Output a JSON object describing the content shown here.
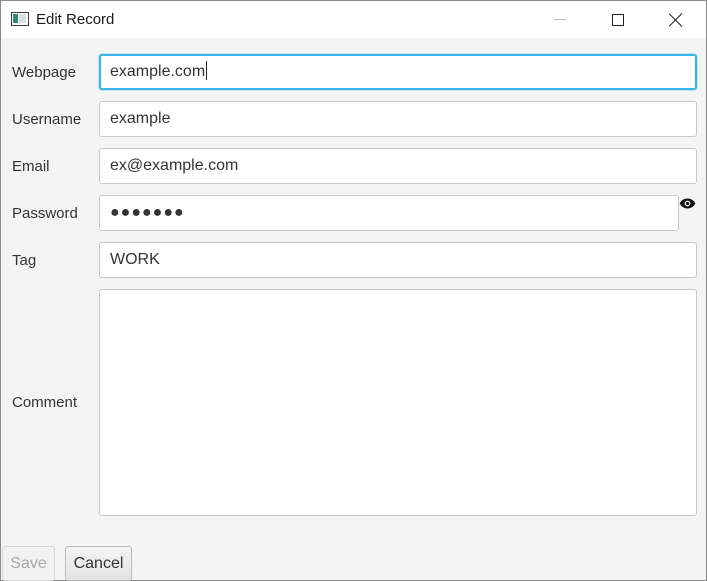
{
  "window": {
    "title": "Edit Record"
  },
  "form": {
    "webpage": {
      "label": "Webpage",
      "value": "example.com"
    },
    "username": {
      "label": "Username",
      "value": "example"
    },
    "email": {
      "label": "Email",
      "value": "ex@example.com"
    },
    "password": {
      "label": "Password",
      "masked_value": "●●●●●●●"
    },
    "tag": {
      "label": "Tag",
      "value": "WORK"
    },
    "comment": {
      "label": "Comment",
      "value": ""
    }
  },
  "buttons": {
    "save": "Save",
    "cancel": "Cancel"
  },
  "icons": {
    "password_toggle": "eye-icon",
    "app": "window-icon"
  },
  "colors": {
    "focus": "#3db4e6",
    "disabled_text": "#a8a8a8"
  }
}
